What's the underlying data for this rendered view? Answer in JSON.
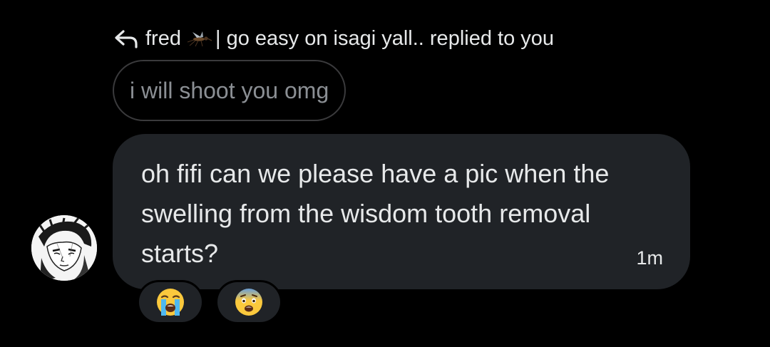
{
  "reply_context": {
    "name": "fred",
    "mosquito_icon": "mosquito-icon",
    "rest": "| go easy on isagi yall.. replied to you"
  },
  "quoted_message": {
    "text": "i will shoot you omg"
  },
  "message": {
    "text": "oh fifi can we please have a pic when the swelling from the wisdom tooth removal starts?",
    "timestamp": "1m"
  },
  "reactions": [
    {
      "emoji": "loudly-crying-face",
      "icon": "loudly-crying-face-icon"
    },
    {
      "emoji": "fearful-face",
      "icon": "fearful-face-icon"
    }
  ],
  "colors": {
    "background": "#000000",
    "bubble": "#202327",
    "text": "#e7e9ea",
    "muted": "#8b8f94"
  }
}
